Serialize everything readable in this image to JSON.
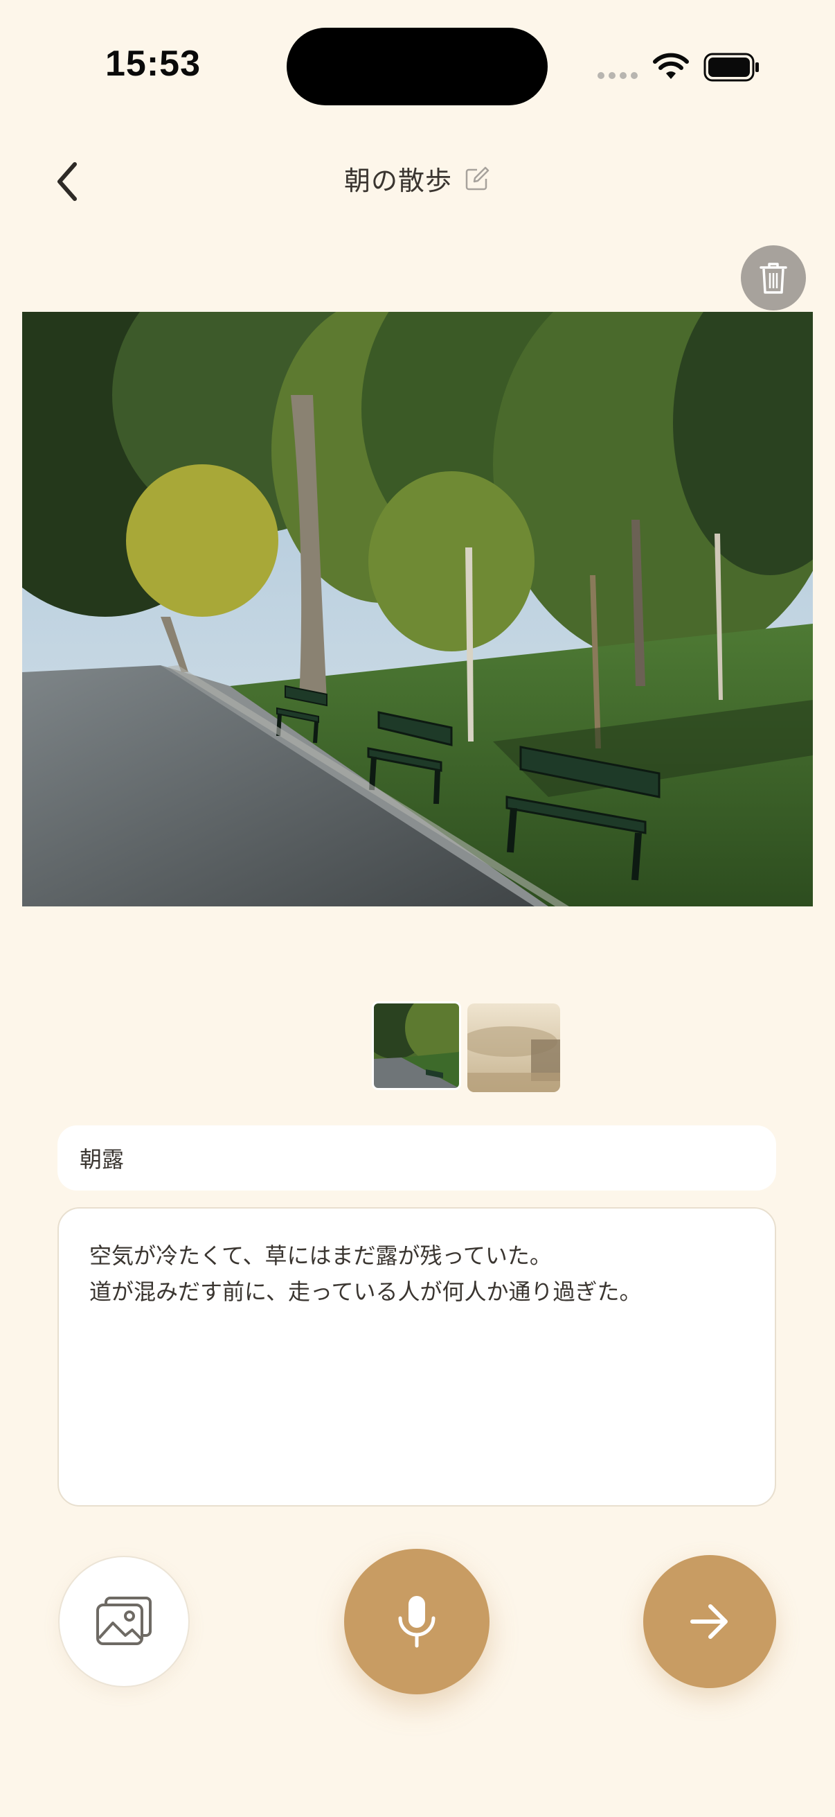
{
  "status_bar": {
    "time": "15:53",
    "icons": [
      "cellular-signal-icon",
      "wifi-icon",
      "battery-icon"
    ]
  },
  "header": {
    "title": "朝の散歩",
    "back_icon": "chevron-left-icon",
    "edit_icon": "edit-icon"
  },
  "photo": {
    "delete_icon": "trash-icon",
    "thumbnails": [
      "park-benches-thumbnail",
      "misty-morning-thumbnail"
    ],
    "selected_index": 0
  },
  "entry": {
    "title_value": "朝露",
    "body_lines": [
      "空気が冷たくて、草にはまだ露が残っていた。",
      "道が混みだす前に、走っている人が何人か通り過ぎた。"
    ]
  },
  "actions": {
    "gallery_icon": "image-gallery-icon",
    "mic_icon": "microphone-icon",
    "next_icon": "arrow-right-icon"
  },
  "colors": {
    "background": "#fdf6ea",
    "accent": "#c89c63",
    "trash_button": "#a7a29c"
  }
}
